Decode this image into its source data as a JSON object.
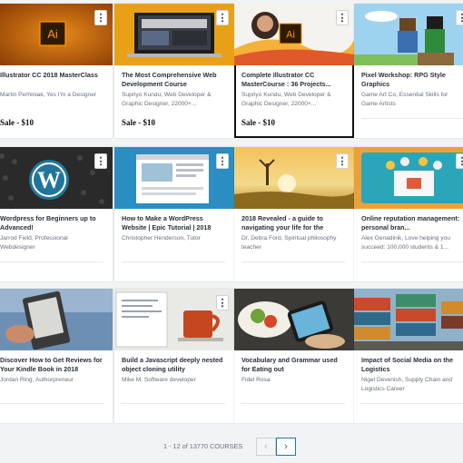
{
  "courses": [
    {
      "title": "Illustrator CC 2018 MasterClass",
      "author": "Martin Perhiniak, Yes I'm a Designer",
      "price": "Sale - $10",
      "thumb": "ai-orange"
    },
    {
      "title": "The Most Comprehensive Web Development Course",
      "author": "Supriyo Kundu, Web Developer & Graphic Designer, 22000+...",
      "price": "Sale - $10",
      "thumb": "laptop"
    },
    {
      "title": "Complete Illustrator CC MasterCourse : 36 Projects...",
      "author": "Supriyo Kundu, Web Developer & Graphic Designer, 22000+...",
      "price": "Sale - $10",
      "thumb": "ai-portrait"
    },
    {
      "title": "Pixel Workshop: RPG Style Graphics",
      "author": "Game Art Co, Essential Skills for Game Artists",
      "price": "",
      "thumb": "pixel"
    },
    {
      "title": "Wordpress for Beginners up to Advanced!",
      "author": "Jarrod Field, Professional Webdesigner",
      "price": "",
      "thumb": "wordpress"
    },
    {
      "title": "How to Make a WordPress Website | Epic Tutorial | 2018",
      "author": "Christopher Henderson, Tutor",
      "price": "",
      "thumb": "wp-screen"
    },
    {
      "title": "2018 Revealed - a guide to navigating your life for the",
      "author": "Dr. Debra Ford, Spiritual philosophy teacher",
      "price": "",
      "thumb": "sunset"
    },
    {
      "title": "Online reputation management: personal bran...",
      "author": "Alex Genadinik, Love helping you succeed: 100,000 students & 1...",
      "price": "",
      "thumb": "reputation"
    },
    {
      "title": "Discover How to Get Reviews for Your Kindle Book in 2018",
      "author": "Jordan Ring, Authorpreneur",
      "price": "",
      "thumb": "kindle"
    },
    {
      "title": "Build a Javascript deeply nested object cloning utility",
      "author": "Mike M, Software developer",
      "price": "",
      "thumb": "coffee"
    },
    {
      "title": "Vocabulary and Grammar used for Eating out",
      "author": "Fidel Rosa",
      "price": "",
      "thumb": "food"
    },
    {
      "title": "Impact of Social Media on the Logistics",
      "author": "Nigel Devenish, Supply Chain and Logistics Career",
      "price": "",
      "thumb": "containers"
    }
  ],
  "menu_glyph": "⋮",
  "ai_logo_text": "Ai",
  "pagination": {
    "summary": "1 - 12 of 13770 COURSES",
    "prev": "‹",
    "next": "›"
  },
  "colors": {
    "accent": "#007791",
    "ai_bg": "#2f1a00",
    "ai_text": "#ff9a00",
    "wp_blue": "#21759b"
  }
}
